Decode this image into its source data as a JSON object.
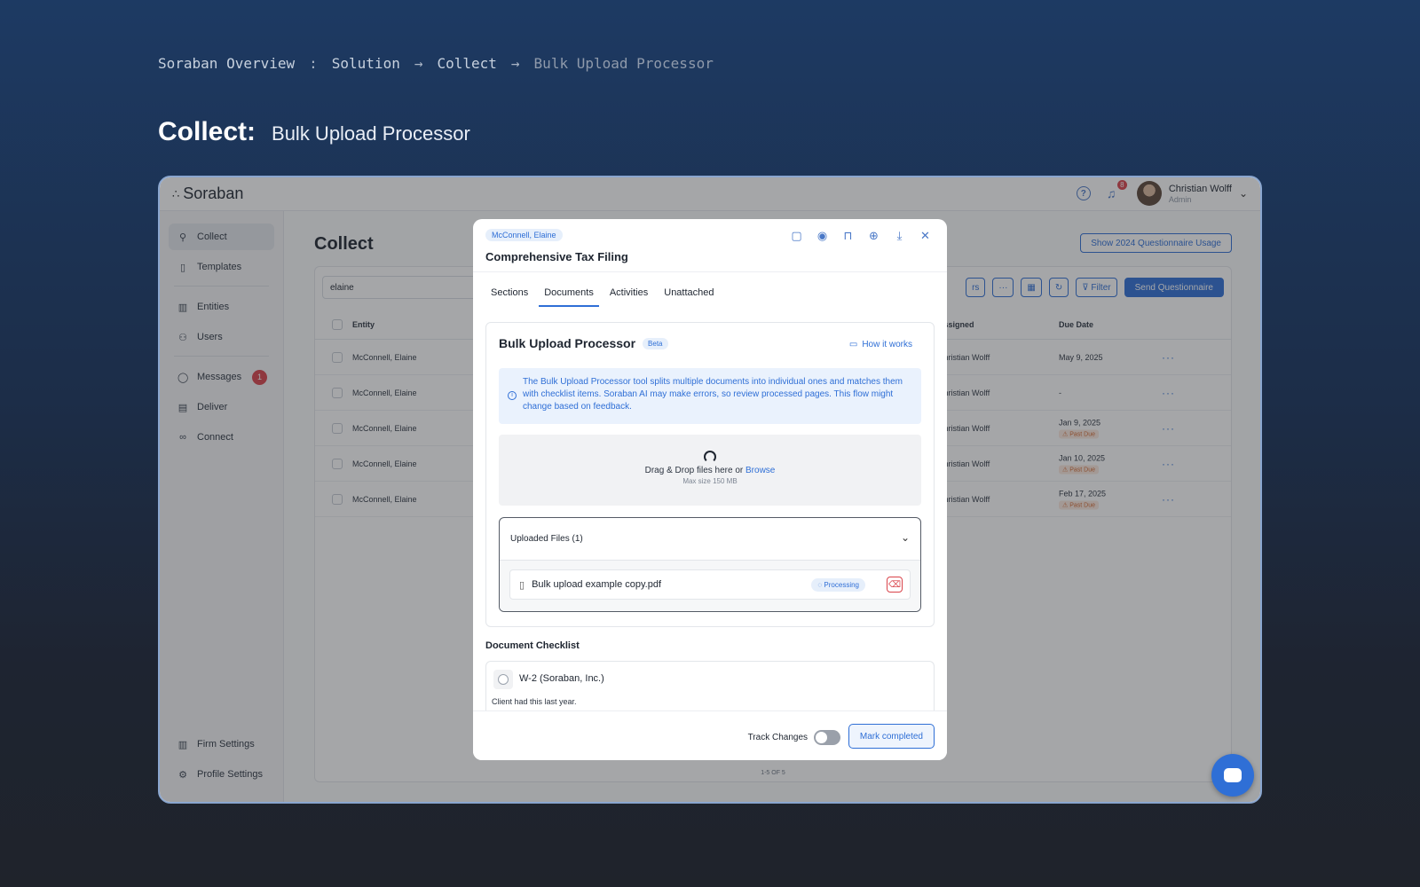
{
  "breadcrumb": {
    "items": [
      "Soraban Overview",
      "Solution",
      "Collect",
      "Bulk Upload Processor"
    ],
    "separators": [
      ":",
      "→",
      "→"
    ]
  },
  "hero": {
    "title": "Collect:",
    "subtitle": "Bulk Upload Processor"
  },
  "app": {
    "logo": "Soraban",
    "notifications_count": "8",
    "user": {
      "name": "Christian Wolff",
      "role": "Admin"
    }
  },
  "sidebar": {
    "items": [
      {
        "label": "Collect",
        "icon": "collect-icon"
      },
      {
        "label": "Templates",
        "icon": "document-icon"
      },
      {
        "label": "Entities",
        "icon": "building-icon"
      },
      {
        "label": "Users",
        "icon": "users-icon"
      },
      {
        "label": "Messages",
        "icon": "message-icon",
        "badge": "1"
      },
      {
        "label": "Deliver",
        "icon": "deliver-icon"
      },
      {
        "label": "Connect",
        "icon": "link-icon"
      }
    ],
    "bottom": [
      {
        "label": "Firm Settings",
        "icon": "building-icon"
      },
      {
        "label": "Profile Settings",
        "icon": "profile-settings-icon"
      }
    ]
  },
  "main": {
    "title": "Collect",
    "usage_button": "Show 2024 Questionnaire Usage",
    "search_value": "elaine",
    "toolbar": {
      "partial_label": "rs",
      "more": "···",
      "filter": "Filter",
      "send": "Send Questionnaire"
    },
    "columns": {
      "entity": "Entity",
      "assigned": "Assigned",
      "due": "Due Date"
    },
    "rows": [
      {
        "entity": "McConnell, Elaine",
        "assigned": "Christian Wolff",
        "due": "May 9, 2025",
        "status": ""
      },
      {
        "entity": "McConnell, Elaine",
        "assigned": "Christian Wolff",
        "due": "-",
        "status": ""
      },
      {
        "entity": "McConnell, Elaine",
        "assigned": "Christian Wolff",
        "due": "Jan 9, 2025",
        "status": "Past Due"
      },
      {
        "entity": "McConnell, Elaine",
        "assigned": "Christian Wolff",
        "due": "Jan 10, 2025",
        "status": "Past Due"
      },
      {
        "entity": "McConnell, Elaine",
        "assigned": "Christian Wolff",
        "due": "Feb 17, 2025",
        "status": "Past Due"
      }
    ],
    "pager": "1-5 OF 5"
  },
  "modal": {
    "chip": "McConnell, Elaine",
    "title": "Comprehensive Tax Filing",
    "tabs": [
      "Sections",
      "Documents",
      "Activities",
      "Unattached"
    ],
    "active_tab": "Documents",
    "bup": {
      "title": "Bulk Upload Processor",
      "badge": "Beta",
      "how": "How it works",
      "info": "The Bulk Upload Processor tool splits multiple documents into individual ones and matches them with checklist items. Soraban AI may make errors, so review processed pages. This flow might change based on feedback.",
      "drop_text": "Drag & Drop files here or",
      "drop_link": "Browse",
      "drop_max": "Max size 150 MB",
      "uploaded_title": "Uploaded Files (1)",
      "file_name": "Bulk upload example copy.pdf",
      "file_status": "Processing"
    },
    "checklist": {
      "title": "Document Checklist",
      "item_name": "W-2 (Soraban, Inc.)",
      "item_note": "Client had this last year."
    },
    "footer": {
      "track_label": "Track Changes",
      "mark_label": "Mark completed"
    }
  },
  "colors": {
    "accent": "#2f6fd6",
    "danger": "#d9434a",
    "past_due": "#d2662d"
  }
}
